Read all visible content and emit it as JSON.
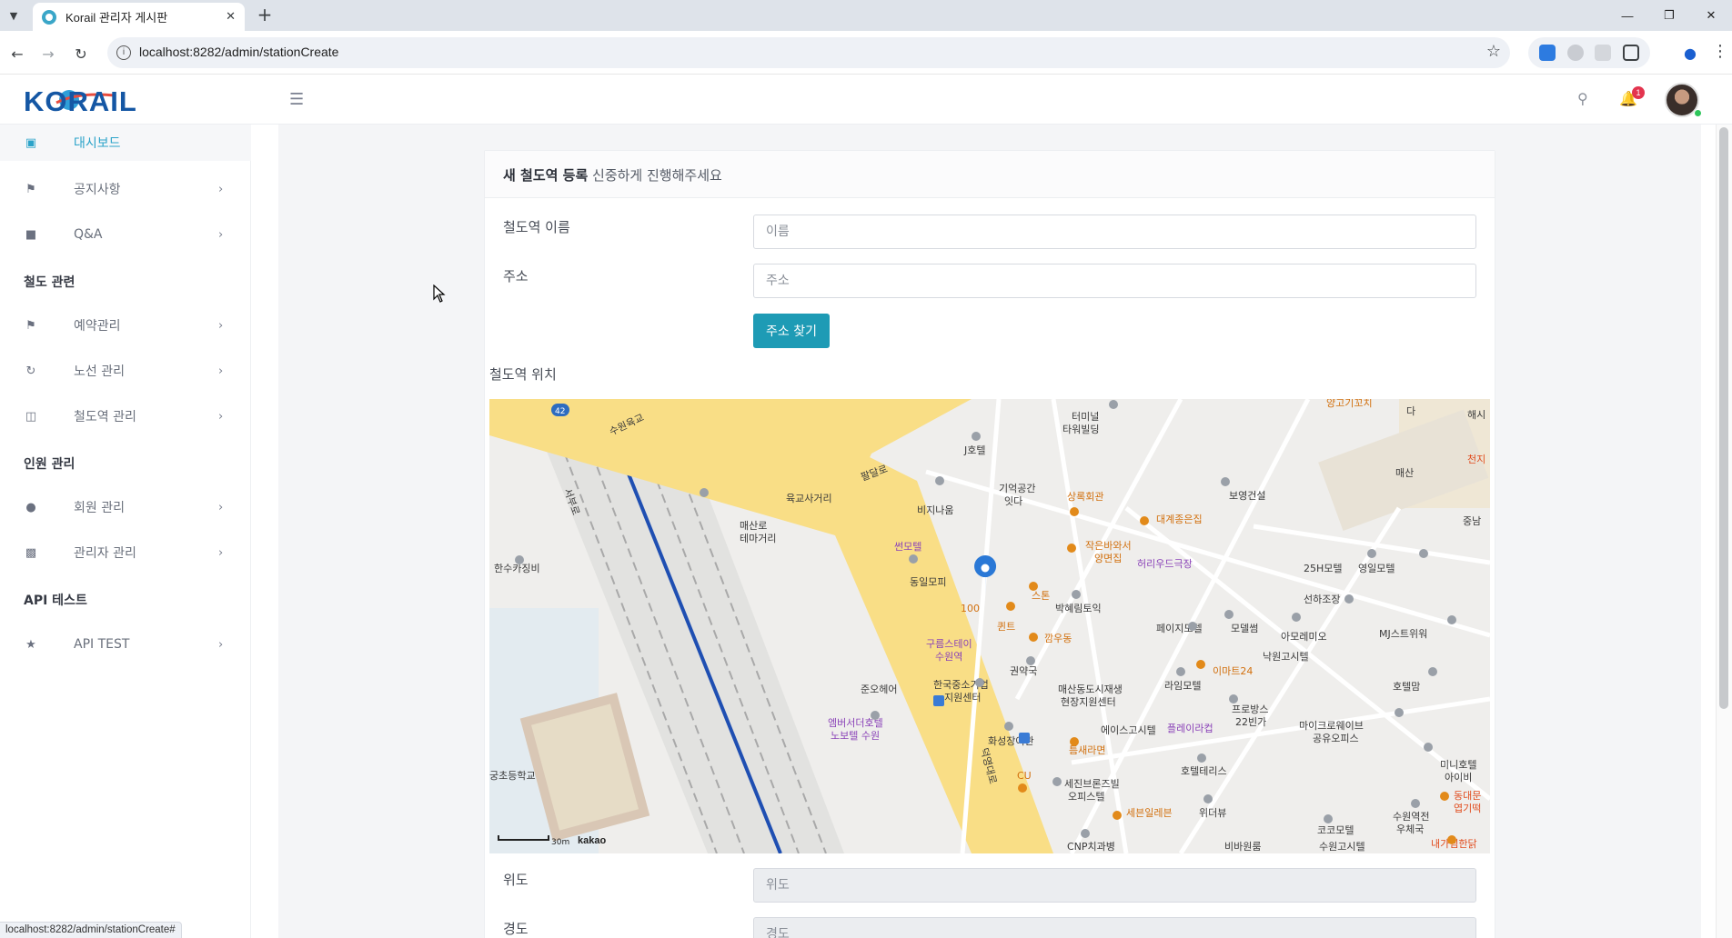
{
  "browser": {
    "tab_title": "Korail 관리자 게시판",
    "url": "localhost:8282/admin/stationCreate",
    "status_url": "localhost:8282/admin/stationCreate#"
  },
  "header": {
    "logo_text": "KORAIL",
    "notification_count": "1"
  },
  "sidebar": {
    "items": [
      {
        "label": "대시보드",
        "icon": "laptop-icon"
      },
      {
        "label": "공지사항",
        "icon": "megaphone-icon"
      },
      {
        "label": "Q&A",
        "icon": "comments-icon"
      },
      {
        "label": "예약관리",
        "icon": "flag-icon"
      },
      {
        "label": "노선 관리",
        "icon": "refresh-icon"
      },
      {
        "label": "철도역 관리",
        "icon": "building-icon"
      },
      {
        "label": "회원 관리",
        "icon": "users-icon"
      },
      {
        "label": "관리자 관리",
        "icon": "briefcase-icon"
      },
      {
        "label": "API TEST",
        "icon": "star-icon"
      }
    ],
    "sections": [
      "철도 관련",
      "인원 관리",
      "API 테스트"
    ]
  },
  "form": {
    "title_bold": "새 철도역 등록",
    "title_rest": "신중하게 진행해주세요",
    "name_label": "철도역 이름",
    "name_placeholder": "이름",
    "address_label": "주소",
    "address_placeholder": "주소",
    "find_address_button": "주소 찾기",
    "location_label": "철도역 위치",
    "lat_label": "위도",
    "lat_placeholder": "위도",
    "lng_label": "경도",
    "lng_placeholder": "경도"
  },
  "map": {
    "scale": "30m",
    "brand": "kakao",
    "road_badge": "42",
    "labels": {
      "terminal": "터미널",
      "terminal_bldg": "타워빌딩",
      "yanggogi": "양고기꼬치",
      "hae": "해시",
      "da": "다",
      "j_hotel": "J호텔",
      "memory_space": "기억공간",
      "itda": "잇다",
      "yukgyo": "육교사거리",
      "bojeong": "보영건설",
      "maesan": "매산",
      "cheonji": "천지",
      "jungang": "중남",
      "biji": "비지나움",
      "maesan_themagori": "매산로",
      "themagori": "테마거리",
      "sanghok": "상록회관",
      "daegye": "대계종은집",
      "sseon": "썬모텔",
      "jakeun": "작은바와서",
      "yangmyeon": "양면집",
      "hollywood": "허리우드극장",
      "suwon_station": "한수카징비",
      "dongil": "동일모피",
      "stone": "스톤",
      "bakhye": "박혜림토익",
      "25h": "25H모텔",
      "youngil": "영일모텔",
      "sunha": "선하조장",
      "perfect": "100",
      "quint": "퀸트",
      "kkam": "깜우동",
      "page": "페이지모텔",
      "model": "모델썸",
      "amore": "아모레미오",
      "mj": "MJ스트위워",
      "gurumsta": "구름스테이",
      "suwon_yeok": "수원역",
      "kwon": "권약국",
      "nakwon": "낙원고시텔",
      "emart": "이마트24",
      "hotel_mam": "호텔맘",
      "junohair": "준오헤어",
      "hanguk": "한국중소기업",
      "jiwon": "지원센터",
      "maesan_dong": "매산동도시재생",
      "hyeonjang": "현장지원센터",
      "laim": "라임모텔",
      "profs": "프로방스",
      "22": "22빈가",
      "micro": "마이크로웨이브",
      "gongyu": "공유오피스",
      "embassy": "엠버서더호텔",
      "nobotel": "노보텔 수원",
      "hwaseong": "화성장여관",
      "ace": "에이스고시텔",
      "flayer": "플레이라컵",
      "teumsae": "틈새라면",
      "hotel_ter": "호텔테리스",
      "mini": "미니호텔",
      "aibi": "아이비",
      "cu": "CU",
      "sejin": "세진브론즈빌",
      "officetel": "오피스텔",
      "seven": "세븐일레븐",
      "widerview": "위더뷰",
      "suwon_gate": "수원역전",
      "uche": "우체국",
      "dongdaemun": "동대문",
      "yeop": "엽기떡",
      "naegi": "내가찜한닭",
      "kokomo": "코코모텔",
      "suwon_go": "수원고시텔",
      "cnp": "CNP치과병",
      "bibi": "비바원룸",
      "suwon_elem": "궁초등학교",
      "street_seoboo": "서부로",
      "street_deokyeong": "덕영대로",
      "street_pyeongdal": "팔달로",
      "street_suwonyukgyo": "수원육교"
    }
  }
}
